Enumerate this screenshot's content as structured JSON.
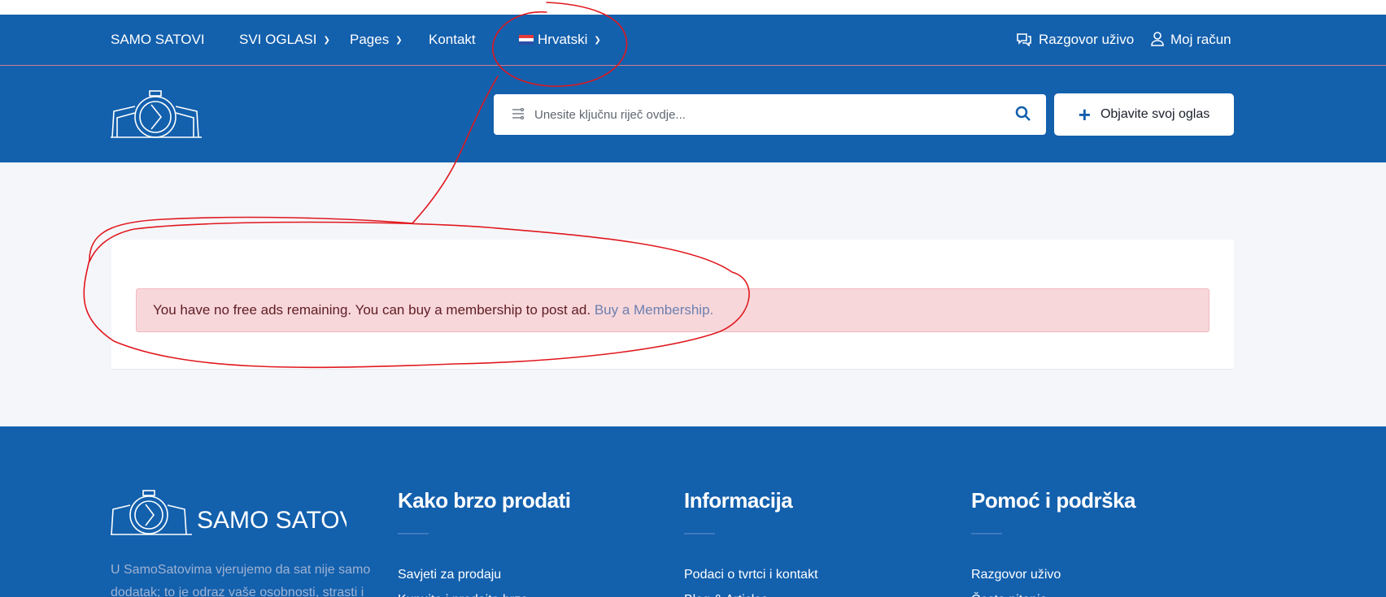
{
  "nav": {
    "brand": "SAMO SATOVI",
    "all_ads": "SVI OGLASI",
    "pages": "Pages",
    "contact": "Kontakt",
    "language": "Hrvatski",
    "live_chat": "Razgovor uživo",
    "account": "Moj račun"
  },
  "header": {
    "search_placeholder": "Unesite ključnu riječ ovdje...",
    "post_ad_label": "Objavite svoj oglas"
  },
  "alert": {
    "message": "You have no free ads remaining. You can buy a membership to post ad.",
    "link_label": "Buy a Membership."
  },
  "footer": {
    "logo_text": "SAMO SATOVI",
    "about_text": "U SamoSatovima vjerujemo da sat nije samo dodatak; to je odraz vaše osobnosti, strasti i",
    "columns": [
      {
        "title": "Kako brzo prodati",
        "links": [
          "Savjeti za prodaju",
          "Kupujte i prodajte brzo"
        ]
      },
      {
        "title": "Informacija",
        "links": [
          "Podaci o tvrtci i kontakt",
          "Blog & Articles"
        ]
      },
      {
        "title": "Pomoć i podrška",
        "links": [
          "Razgovor uživo",
          "Česta pitanja"
        ]
      }
    ]
  },
  "colors": {
    "brand_blue": "#1360ad",
    "alert_bg": "#f8d7da",
    "alert_text": "#5e1d24",
    "alert_link": "#6b7fb0",
    "annotation_red": "#e0181e"
  },
  "icons": [
    "chevron-down-icon",
    "croatian-flag-icon",
    "chat-icon",
    "user-icon",
    "watch-logo",
    "category-icon",
    "search-icon",
    "plus-icon"
  ]
}
